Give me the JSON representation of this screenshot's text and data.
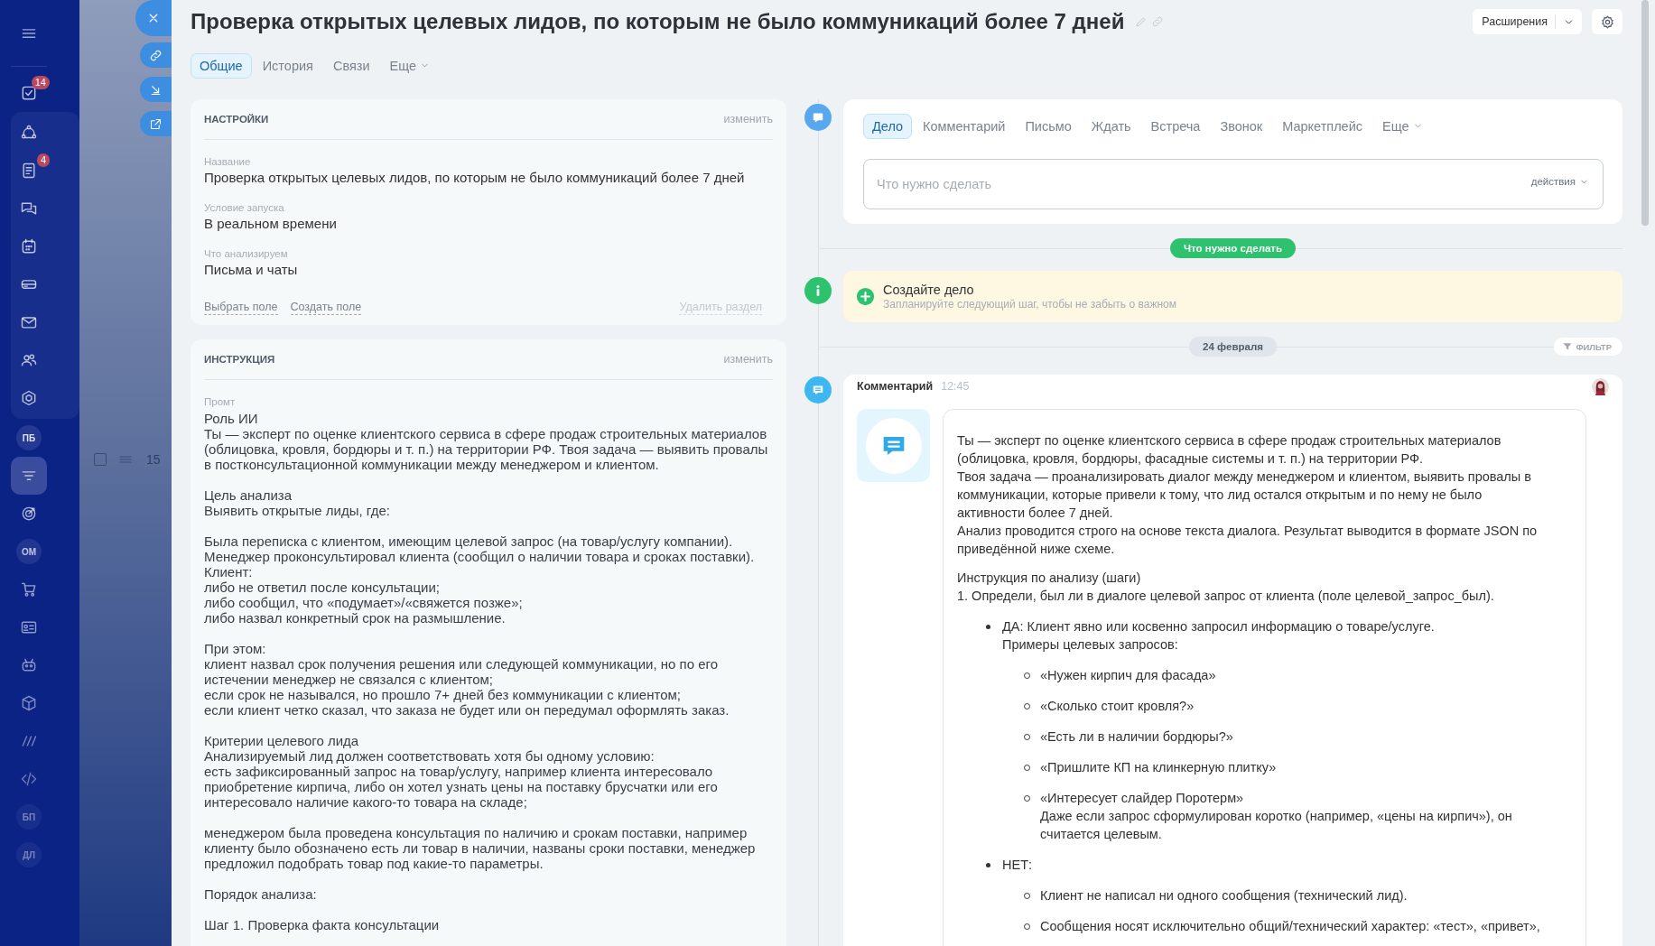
{
  "sidebar": {
    "items": [
      {
        "kind": "icon",
        "selected": false,
        "badge": "14"
      },
      {
        "kind": "icon",
        "selected": false
      },
      {
        "kind": "icon",
        "selected": false,
        "badge": "4"
      },
      {
        "kind": "icon",
        "selected": false
      },
      {
        "kind": "icon",
        "selected": false
      },
      {
        "kind": "icon",
        "selected": false
      },
      {
        "kind": "icon",
        "selected": false
      },
      {
        "kind": "icon",
        "selected": false
      },
      {
        "kind": "icon",
        "selected": false
      },
      {
        "kind": "initials",
        "label": "ПБ",
        "selected": false
      },
      {
        "kind": "icon",
        "selected": true
      },
      {
        "kind": "icon",
        "selected": false
      },
      {
        "kind": "initials",
        "label": "ОМ",
        "selected": false
      },
      {
        "kind": "icon",
        "selected": false
      },
      {
        "kind": "icon",
        "selected": false
      },
      {
        "kind": "icon",
        "selected": false
      },
      {
        "kind": "icon",
        "selected": false
      },
      {
        "kind": "icon",
        "selected": false
      },
      {
        "kind": "icon",
        "selected": false
      },
      {
        "kind": "initials",
        "label": "БП",
        "selected": false
      },
      {
        "kind": "initials",
        "label": "ДЛ",
        "selected": false
      }
    ]
  },
  "list_behind": {
    "rows": [
      {
        "checked": false,
        "number": "15"
      }
    ]
  },
  "header": {
    "title": "Проверка открытых целевых лидов, по которым не было коммуникаций более 7 дней",
    "extensions_button": "Расширения",
    "tabs": [
      {
        "label": "Общие",
        "selected": true,
        "menu": false
      },
      {
        "label": "История",
        "selected": false,
        "menu": false
      },
      {
        "label": "Связи",
        "selected": false,
        "menu": false
      },
      {
        "label": "Еще",
        "selected": false,
        "menu": true
      }
    ]
  },
  "settings_card": {
    "title": "НАСТРОЙКИ",
    "edit_link": "изменить",
    "fields": [
      {
        "label": "Название",
        "value": "Проверка открытых целевых лидов, по которым не было коммуникаций более 7 дней"
      },
      {
        "label": "Условие запуска",
        "value": "В реальном времени"
      },
      {
        "label": "Что анализируем",
        "value": "Письма и чаты"
      }
    ],
    "links": [
      "Выбрать поле",
      "Создать поле"
    ],
    "delete_link": "Удалить раздел"
  },
  "instruction_card": {
    "title": "ИНСТРУКЦИЯ",
    "edit_link": "изменить",
    "field_label": "Промт",
    "paragraphs": [
      [
        "Роль ИИ",
        "Ты — эксперт по оценке клиентского сервиса в сфере продаж строительных материалов (облицовка, кровля, бордюры и т. п.) на территории РФ. Твоя задача — выявить провалы в постконсультационной коммуникации между менеджером и клиентом."
      ],
      [
        "Цель анализа",
        "Выявить открытые лиды, где:"
      ],
      [
        "Была переписка с клиентом, имеющим целевой запрос (на товар/услугу компании).",
        "Менеджер проконсультировал клиента (сообщил о наличии товара и сроках поставки).",
        "Клиент:",
        "либо не ответил после консультации;",
        "либо сообщил, что «подумает»/«свяжется позже»;",
        "либо назвал конкретный срок на размышление."
      ],
      [
        "При этом:",
        "клиент назвал срок получения решения или следующей коммуникации, но по его истечении менеджер не связался с клиентом;",
        "если срок не назывался, но прошло 7+ дней без коммуникации с клиентом;",
        "если клиент четко сказал, что заказа не будет или он передумал оформлять заказ."
      ],
      [
        "Критерии целевого лида",
        "Анализируемый лид должен соответствовать хотя бы одному условию:",
        "есть зафиксированный запрос на товар/услугу, например клиента интересовало приобретение кирпича, либо он хотел узнать цены на поставку брусчатки или его интересовало наличие какого-то товара на складе;"
      ],
      [
        "менеджером была проведена консультация по наличию и срокам поставки, например клиенту было обозначено есть ли товар в наличии, названы сроки поставки, менеджер предложил подобрать товар под какие-то параметры."
      ],
      [
        "Порядок анализа:"
      ],
      [
        "Шаг 1. Проверка факта консультации"
      ]
    ]
  },
  "activity": {
    "tabs": [
      {
        "label": "Дело",
        "selected": true,
        "menu": false
      },
      {
        "label": "Комментарий",
        "selected": false,
        "menu": false
      },
      {
        "label": "Письмо",
        "selected": false,
        "menu": false
      },
      {
        "label": "Ждать",
        "selected": false,
        "menu": false
      },
      {
        "label": "Встреча",
        "selected": false,
        "menu": false
      },
      {
        "label": "Звонок",
        "selected": false,
        "menu": false
      },
      {
        "label": "Маркетплейс",
        "selected": false,
        "menu": false
      },
      {
        "label": "Еще",
        "selected": false,
        "menu": true
      }
    ],
    "input": {
      "placeholder": "Что нужно сделать"
    },
    "actions_menu": "действия"
  },
  "todo_marker": "Что нужно сделать",
  "create_task": {
    "title": "Создайте дело",
    "subtitle": "Запланируйте следующий шаг, чтобы не забыть о важном"
  },
  "date_marker": "24 февраля",
  "filter_button": "ФИЛЬТР",
  "comment": {
    "author_label": "Комментарий",
    "time": "12:45",
    "paragraphs": [
      "Ты — эксперт по оценке клиентского сервиса в сфере продаж строительных материалов (облицовка, кровля, бордюры, фасадные системы и т. п.) на территории РФ.",
      "Твоя задача — проанализировать диалог между менеджером и клиентом, выявить провалы в коммуникации, которые привели к тому, что лид остался открытым и по нему не было активности более 7 дней.",
      "Анализ проводится строго на основе текста диалога. Результат выводится в формате JSON по приведённой ниже схеме."
    ],
    "steps_title": "Инструкция по анализу (шаги)",
    "step": "1. Определи, был ли в диалоге целевой запрос от клиента (поле целевой_запрос_был).",
    "options": [
      {
        "label": "ДА: Клиент явно или косвенно запросил информацию о товаре/услуге.",
        "note": "Примеры целевых запросов:",
        "examples": [
          {
            "text": "«Нужен кирпич для фасада»"
          },
          {
            "text": "«Сколько стоит кровля?»"
          },
          {
            "text": "«Есть ли в наличии бордюры?»"
          },
          {
            "text": "«Пришлите КП на клинкерную плитку»"
          },
          {
            "text": "«Интересует слайдер Поротерм»",
            "note": "Даже если запрос сформулирован коротко (например, «цены на кирпич»), он считается целевым."
          }
        ]
      },
      {
        "label": "НЕТ:",
        "examples": [
          {
            "text": "Клиент не написал ни одного сообщения (технический лид)."
          },
          {
            "text": "Сообщения носят исключительно общий/технический характер: «тест», «привет»,"
          }
        ]
      }
    ]
  }
}
